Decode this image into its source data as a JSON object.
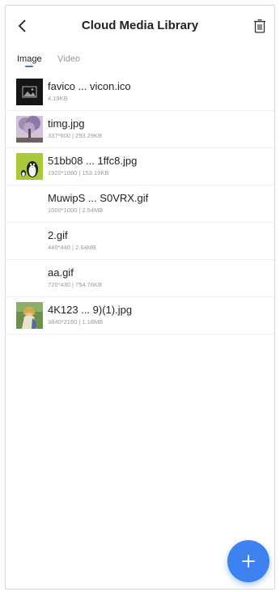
{
  "header": {
    "title": "Cloud Media Library"
  },
  "tabs": [
    {
      "label": "Image",
      "active": true
    },
    {
      "label": "Video",
      "active": false
    }
  ],
  "files": [
    {
      "name": "favico ... vicon.ico",
      "meta": "4.19KB",
      "thumb": "dark-image-placeholder"
    },
    {
      "name": "timg.jpg",
      "meta": "337*600 | 293.29KB",
      "thumb": "lavender-tree-photo"
    },
    {
      "name": "51bb08 ... 1ffc8.jpg",
      "meta": "1920*1080 | 153.19KB",
      "thumb": "green-penguin-cartoon"
    },
    {
      "name": "MuwipS ... S0VRX.gif",
      "meta": "1000*1000 | 2.54MB",
      "thumb": ""
    },
    {
      "name": "2.gif",
      "meta": "440*440 | 2.64MB",
      "thumb": ""
    },
    {
      "name": "aa.gif",
      "meta": "720*430 | 754.76KB",
      "thumb": ""
    },
    {
      "name": "4K123 ... 9)(1).jpg",
      "meta": "3840*2160 | 1.18MB",
      "thumb": "anime-girl-painting"
    }
  ],
  "icons": {
    "back": "chevron-left-icon",
    "delete": "trash-icon",
    "add": "plus-icon"
  },
  "colors": {
    "accent": "#3d82ee",
    "tab_indicator": "#3a7bd5"
  }
}
